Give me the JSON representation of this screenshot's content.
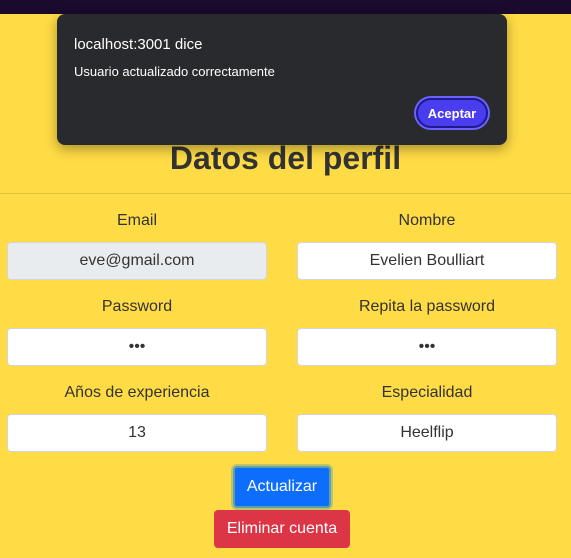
{
  "dialog": {
    "origin": "localhost:3001 dice",
    "message": "Usuario actualizado correctamente",
    "ok_label": "Aceptar"
  },
  "page": {
    "title": "Datos del perfil"
  },
  "form": {
    "email": {
      "label": "Email",
      "value": "eve@gmail.com"
    },
    "nombre": {
      "label": "Nombre",
      "value": "Evelien Boulliart"
    },
    "password": {
      "label": "Password",
      "value": "•••"
    },
    "repeat_password": {
      "label": "Repita la password",
      "value": "•••"
    },
    "experiencia": {
      "label": "Años de experiencia",
      "value": "13"
    },
    "especialidad": {
      "label": "Especialidad",
      "value": "Heelflip"
    }
  },
  "actions": {
    "update_label": "Actualizar",
    "delete_label": "Eliminar cuenta"
  },
  "colors": {
    "background": "#FFDB45",
    "primary": "#0d6efd",
    "danger": "#dc3545",
    "dialog_bg": "#292a2d",
    "dialog_button": "#4a3df0"
  }
}
